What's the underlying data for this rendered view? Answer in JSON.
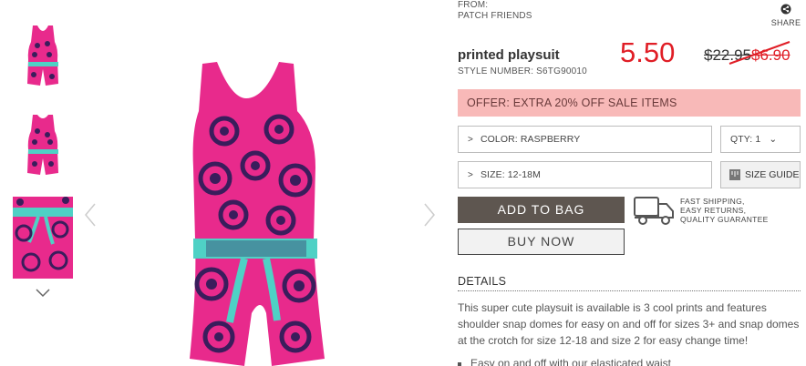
{
  "gallery": {
    "thumbnails": [
      "thumbnail-front",
      "thumbnail-back",
      "thumbnail-detail"
    ],
    "icons": {
      "down": "chevron-down-icon",
      "prev": "chevron-left-icon",
      "next": "chevron-right-icon"
    },
    "colors": {
      "fabric": "#e82a8c",
      "print": "#3a1d5c",
      "sash": "#4fd1c5"
    }
  },
  "product": {
    "from_label": "FROM:",
    "brand": "PATCH FRIENDS",
    "title": "printed playsuit",
    "style_number": "STYLE NUMBER: S6TG90010",
    "sale_price": "5.50",
    "original_price": "$22.95",
    "mid_price": "$6.90",
    "sale_color": "#e01e26"
  },
  "share": {
    "label": "SHARE",
    "icon": "share-icon"
  },
  "offer": {
    "text": "OFFER: EXTRA 20% OFF SALE ITEMS",
    "color": "#f8b9b8"
  },
  "options": {
    "color_label": "COLOR: RASPBERRY",
    "qty_label": "QTY: 1",
    "size_label": "SIZE: 12-18M",
    "size_guide": "SIZE GUIDE"
  },
  "actions": {
    "add_to_bag": "ADD TO BAG",
    "buy_now": "BUY NOW"
  },
  "shipping": {
    "line1": "FAST SHIPPING,",
    "line2": "EASY RETURNS,",
    "line3": "QUALITY GUARANTEE",
    "icon": "truck-icon"
  },
  "details": {
    "heading": "DETAILS",
    "description": "This super cute playsuit is available is 3 cool prints and features shoulder snap domes for easy on and off for sizes 3+ and snap domes at the crotch for size 12-18 and size 2 for easy change time!",
    "bullet": "Easy on and off with our elasticated waist"
  }
}
